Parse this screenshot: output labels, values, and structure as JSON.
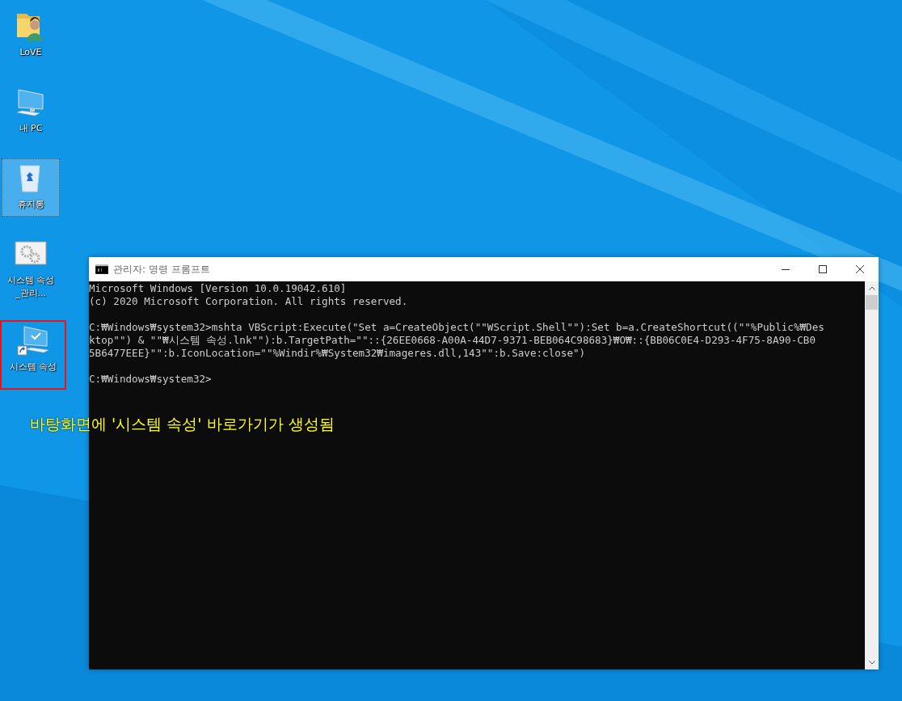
{
  "desktop": {
    "icons": [
      {
        "kind": "user-folder",
        "label": "LoVE",
        "selected": false,
        "highlighted": false
      },
      {
        "kind": "computer",
        "label": "내 PC",
        "selected": false,
        "highlighted": false
      },
      {
        "kind": "recycle-bin",
        "label": "휴지통",
        "selected": true,
        "highlighted": false
      },
      {
        "kind": "settings-window",
        "label": "시스템 속성_관리...",
        "selected": false,
        "highlighted": false
      },
      {
        "kind": "shortcut-computer",
        "label": "시스템 속성",
        "selected": false,
        "highlighted": true
      }
    ]
  },
  "window": {
    "title": "관리자: 명령 프롬프트",
    "console_blocks": [
      {
        "lines": [
          "Microsoft Windows [Version 10.0.19042.610]",
          "(c) 2020 Microsoft Corporation. All rights reserved."
        ]
      },
      {
        "lines": [
          "C:₩Windows₩system32>mshta VBScript:Execute(\"Set a=CreateObject(\"\"WScript.Shell\"\"):Set b=a.CreateShortcut((\"\"%Public%₩Des",
          "ktop\"\") & \"\"₩시스템 속성.lnk\"\"):b.TargetPath=\"\"::{26EE0668-A00A-44D7-9371-BEB064C98683}₩O₩::{BB06C0E4-D293-4F75-8A90-CB0",
          "5B6477EEE}\"\":b.IconLocation=\"\"%Windir%₩System32₩imageres.dll,143\"\":b.Save:close\")"
        ]
      },
      {
        "lines": [
          "C:₩Windows₩system32>"
        ]
      }
    ]
  },
  "annotation": "바탕화면에 '시스템 속성' 바로가기가 생성됨"
}
